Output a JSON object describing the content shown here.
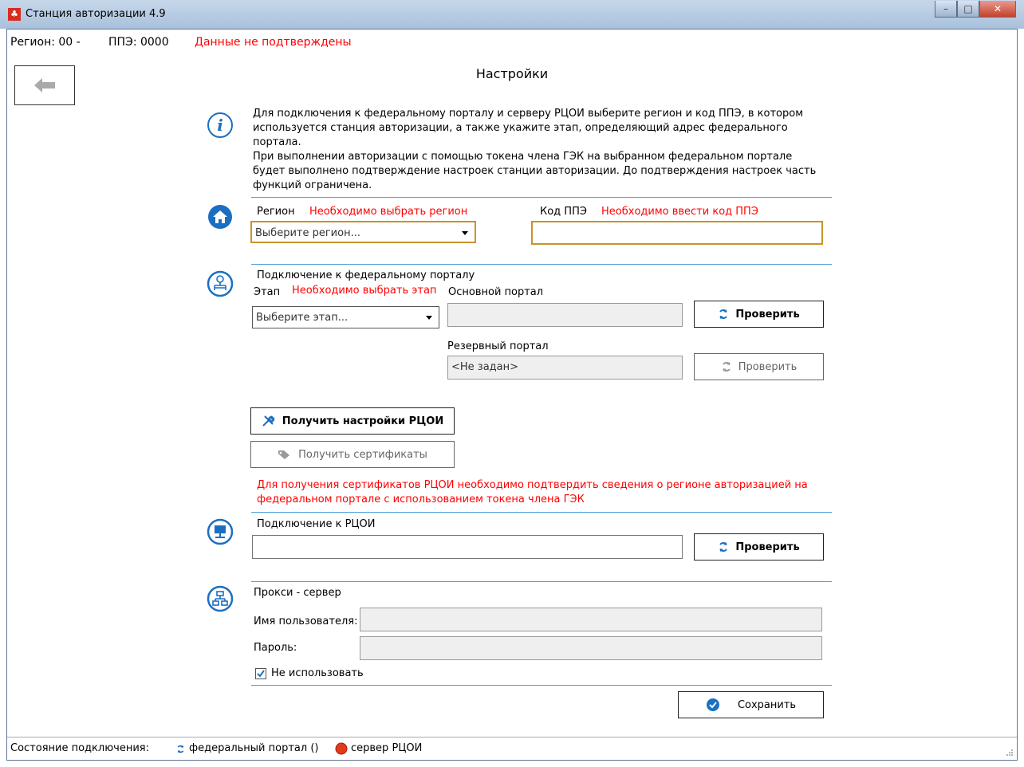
{
  "window": {
    "title": "Станция авторизации 4.9",
    "min_glyph": "–",
    "max_glyph": "□",
    "close_glyph": "✕"
  },
  "topbar": {
    "region": "Регион: 00 -",
    "ppe": "ППЭ: 0000",
    "status": "Данные не подтверждены"
  },
  "page": {
    "title": "Настройки"
  },
  "info": {
    "text": "Для подключения к федеральному порталу и серверу РЦОИ выберите регион и код ППЭ, в котором используется станция авторизации, а также укажите этап, определяющий адрес федерального портала.\nПри выполнении авторизации с помощью токена члена ГЭК на выбранном федеральном портале будет выполнено подтверждение настроек станции авторизации. До подтверждения настроек часть функций ограничена."
  },
  "region": {
    "label": "Регион",
    "error": "Необходимо выбрать регион",
    "selected": "Выберите регион...",
    "code_label": "Код ППЭ",
    "code_error": "Необходимо ввести код ППЭ",
    "code_value": ""
  },
  "portal": {
    "title": "Подключение к федеральному порталу",
    "stage_label": "Этап",
    "stage_error": "Необходимо выбрать этап",
    "stage_selected": "Выберите этап...",
    "main_label": "Основной портал",
    "main_value": "",
    "check_label": "Проверить",
    "reserve_label": "Резервный портал",
    "reserve_value": "<Не задан>",
    "reserve_check_label": "Проверить"
  },
  "rcoi": {
    "get_settings_label": "Получить настройки РЦОИ",
    "get_certs_label": "Получить сертификаты",
    "cert_warning": "Для получения сертификатов РЦОИ необходимо подтвердить сведения о регионе авторизацией на федеральном портале с использованием токена члена ГЭК",
    "conn_title": "Подключение к РЦОИ",
    "conn_value": "",
    "check_label": "Проверить"
  },
  "proxy": {
    "title": "Прокси - сервер",
    "user_label": "Имя пользователя:",
    "user_value": "",
    "pass_label": "Пароль:",
    "pass_value": "",
    "no_use_label": "Не использовать",
    "no_use_checked": true
  },
  "save_label": "Сохранить",
  "statusbar": {
    "label": "Состояние подключения:",
    "portal": "федеральный портал ()",
    "rcoi": "сервер РЦОИ"
  },
  "colors": {
    "accent": "#1a6fc2",
    "error": "#ff0000",
    "separator": "#4aa0d8",
    "highlight": "#c8942a"
  }
}
